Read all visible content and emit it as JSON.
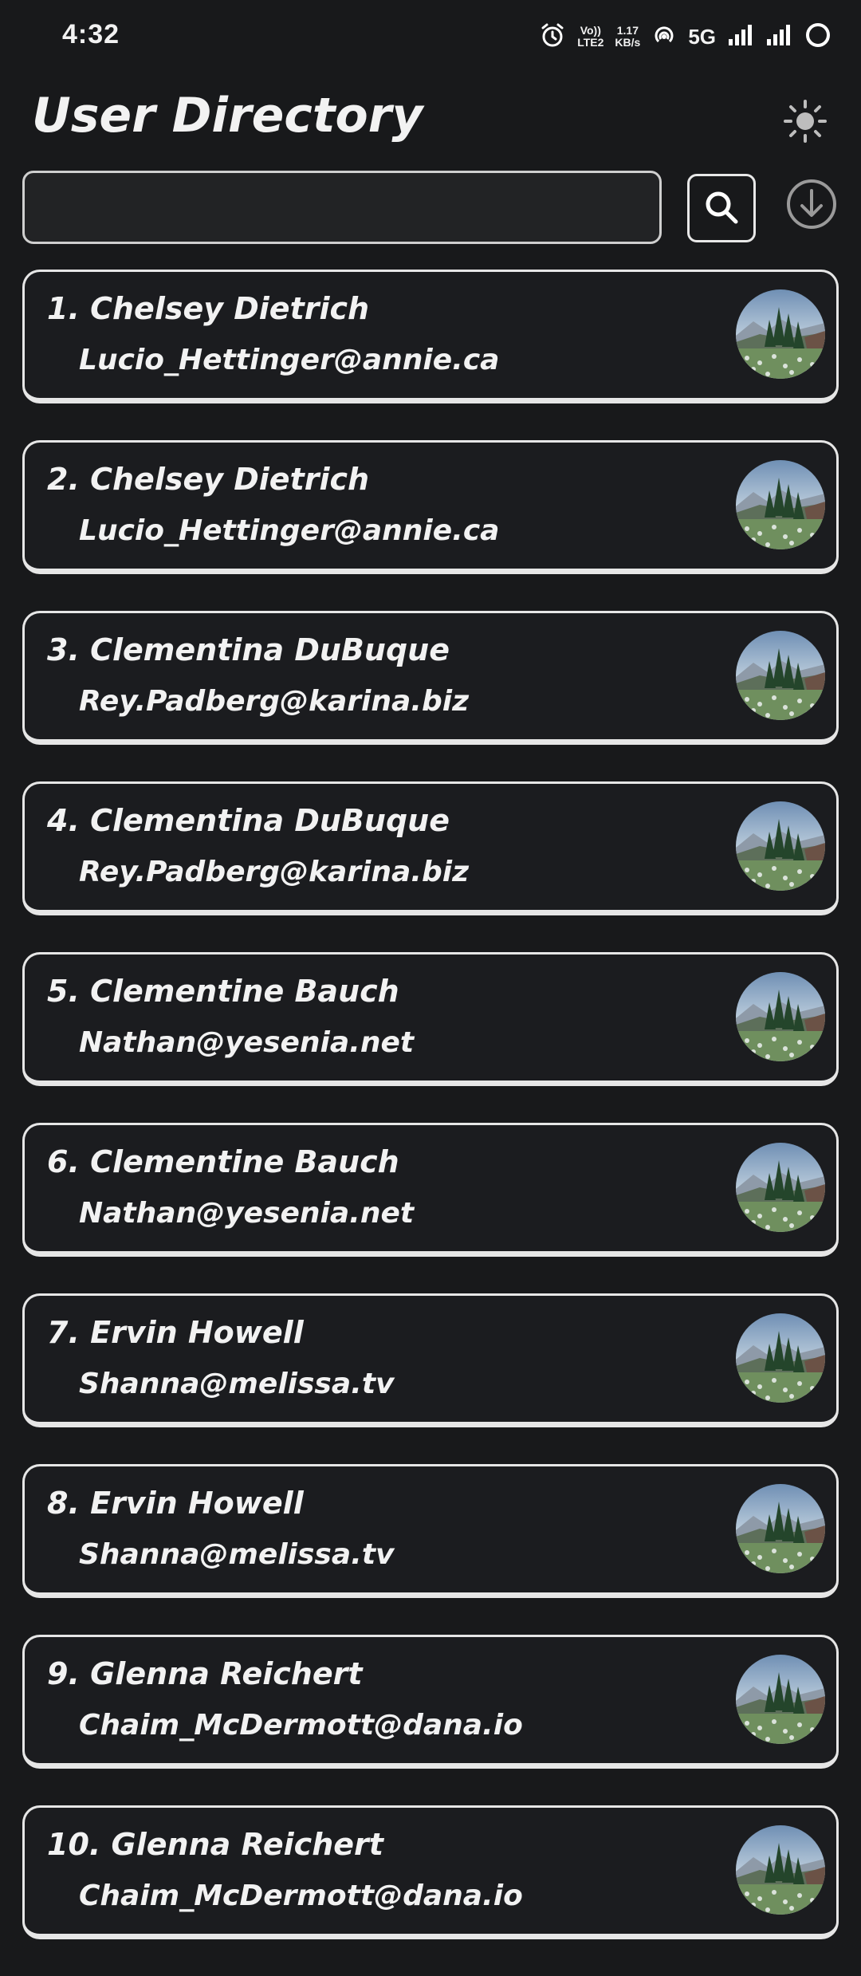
{
  "status_bar": {
    "time": "4:32",
    "network_top": "Vo))",
    "network_bottom": "LTE2",
    "speed_top": "1.17",
    "speed_bottom": "KB/s",
    "network_type": "5G"
  },
  "header": {
    "title": "User Directory"
  },
  "search": {
    "value": "",
    "placeholder": ""
  },
  "users": [
    {
      "label": "1. Chelsey Dietrich",
      "email": "Lucio_Hettinger@annie.ca"
    },
    {
      "label": "2. Chelsey Dietrich",
      "email": "Lucio_Hettinger@annie.ca"
    },
    {
      "label": "3. Clementina DuBuque",
      "email": "Rey.Padberg@karina.biz"
    },
    {
      "label": "4. Clementina DuBuque",
      "email": "Rey.Padberg@karina.biz"
    },
    {
      "label": "5. Clementine Bauch",
      "email": "Nathan@yesenia.net"
    },
    {
      "label": "6. Clementine Bauch",
      "email": "Nathan@yesenia.net"
    },
    {
      "label": "7. Ervin Howell",
      "email": "Shanna@melissa.tv"
    },
    {
      "label": "8. Ervin Howell",
      "email": "Shanna@melissa.tv"
    },
    {
      "label": "9. Glenna Reichert",
      "email": "Chaim_McDermott@dana.io"
    },
    {
      "label": "10. Glenna Reichert",
      "email": "Chaim_McDermott@dana.io"
    }
  ],
  "icons": {
    "theme": "sun-icon",
    "search": "search-icon",
    "download": "download-icon",
    "avatar": "landscape-avatar"
  },
  "colors": {
    "background": "#18191b",
    "card_border": "#e6e6e6",
    "text": "#f2f2f2"
  }
}
